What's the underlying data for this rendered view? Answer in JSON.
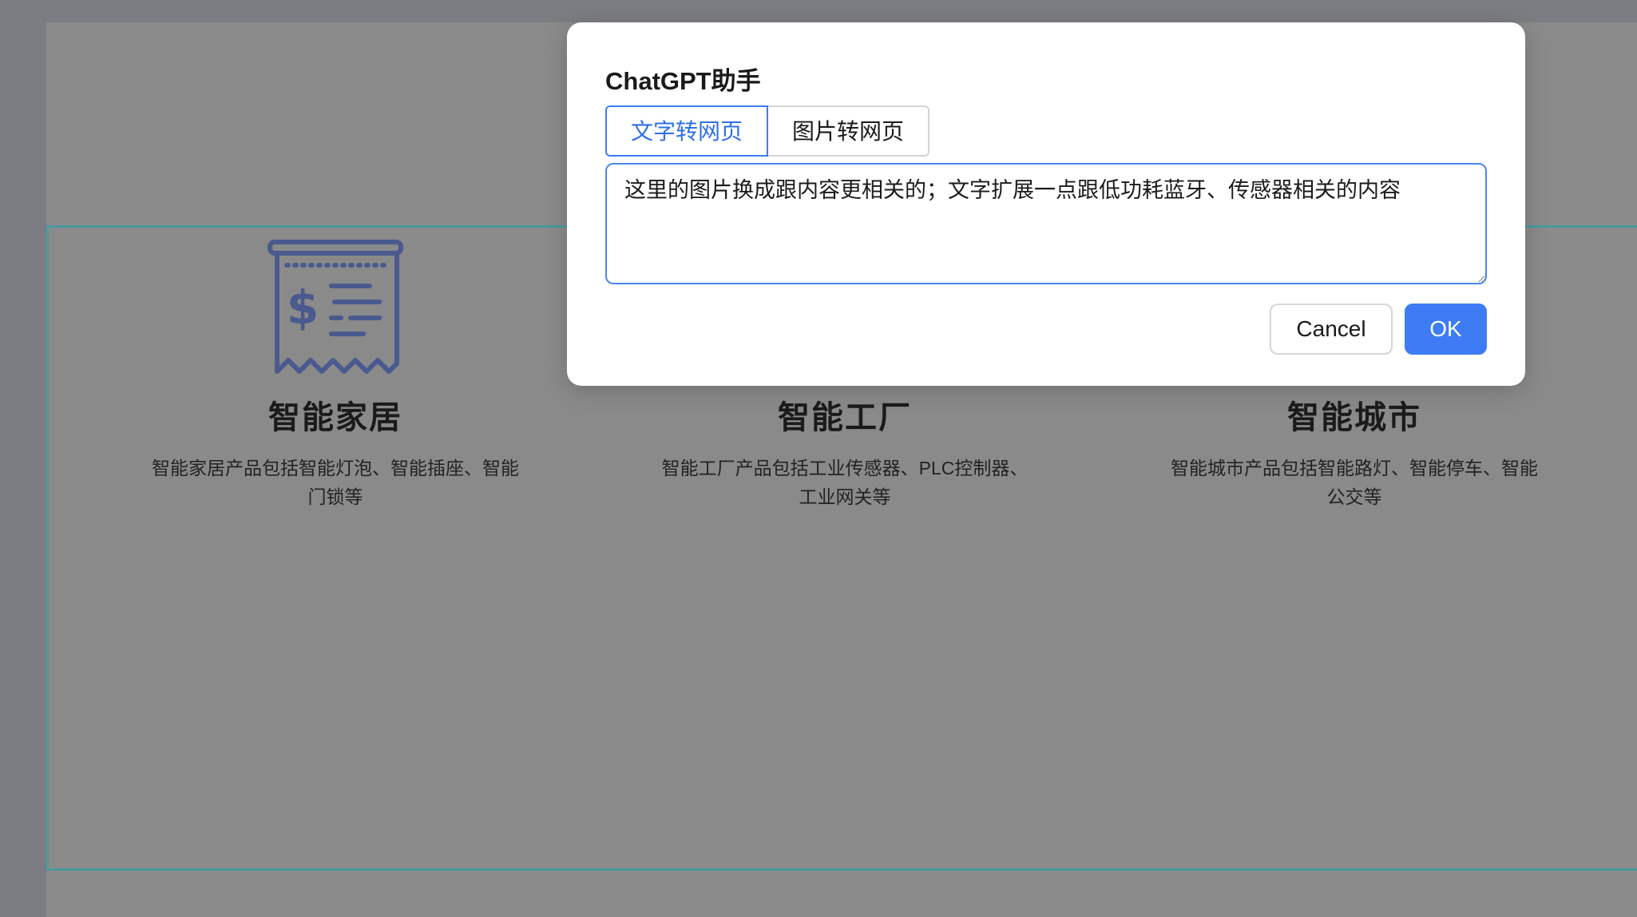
{
  "modal": {
    "title": "ChatGPT助手",
    "tabs": [
      {
        "label": "文字转网页",
        "active": true
      },
      {
        "label": "图片转网页",
        "active": false
      }
    ],
    "input": {
      "value": "这里的图片换成跟内容更相关的；文字扩展一点跟低功耗蓝牙、传感器相关的内容"
    },
    "cancel_label": "Cancel",
    "ok_label": "OK"
  },
  "features": [
    {
      "icon": "receipt-icon",
      "title": "智能家居",
      "description": "智能家居产品包括智能灯泡、智能插座、智能门锁等"
    },
    {
      "icon": "presentation-chart-icon",
      "title": "智能工厂",
      "description": "智能工厂产品包括工业传感器、PLC控制器、工业网关等"
    },
    {
      "icon": "growth-bar-chart-icon",
      "title": "智能城市",
      "description": "智能城市产品包括智能路灯、智能停车、智能公交等"
    }
  ],
  "colors": {
    "accent": "#3d7cf5",
    "icon": "#4a5a8f",
    "section_border": "#4a9aa0"
  }
}
